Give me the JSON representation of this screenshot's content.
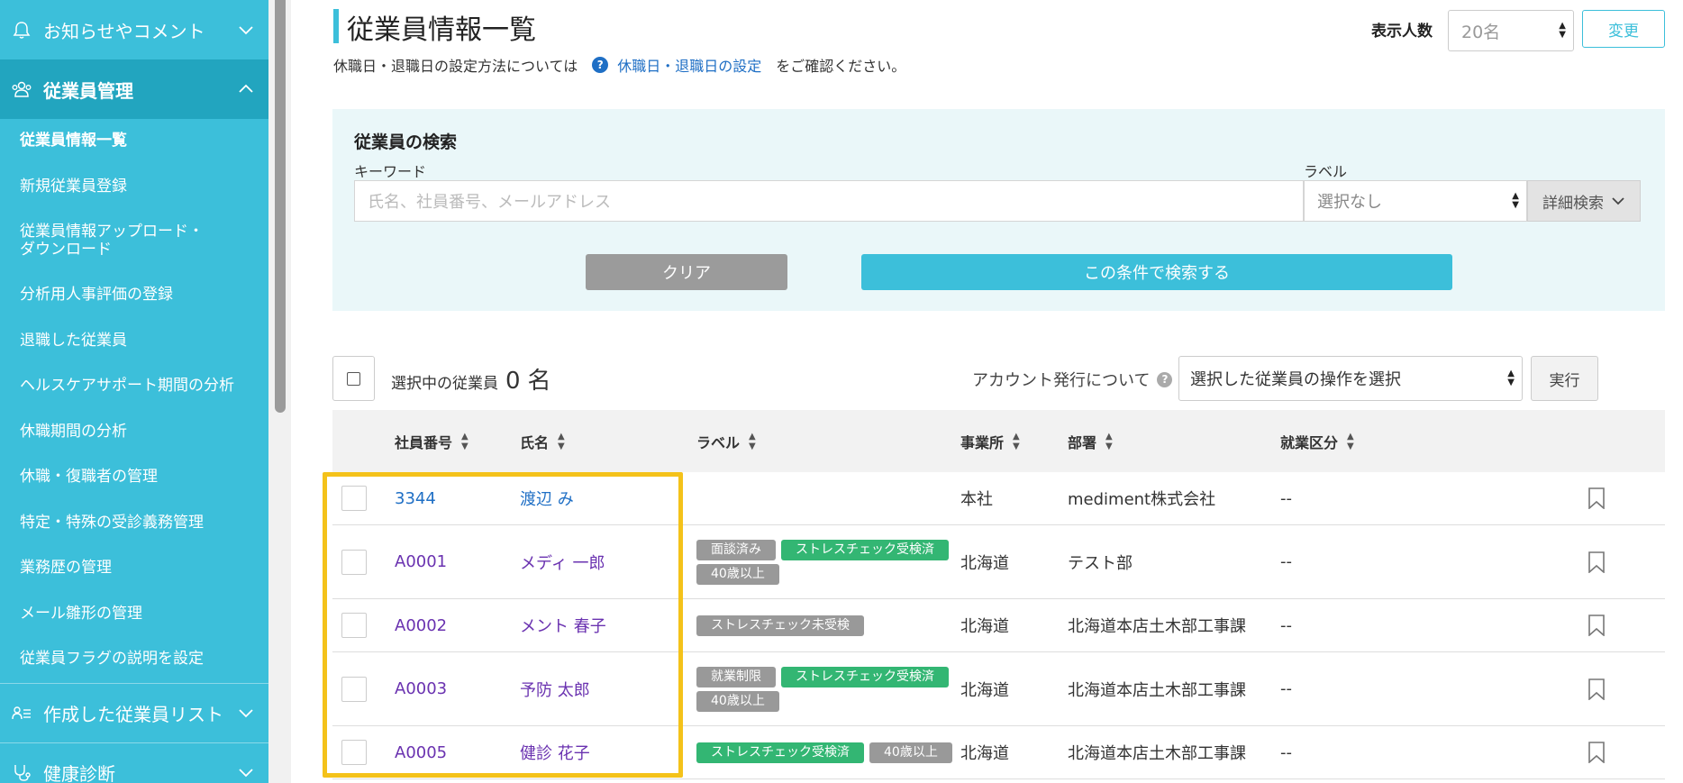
{
  "sidebar": {
    "sections": {
      "notices": "お知らせやコメント",
      "employee_mgmt": "従業員管理",
      "lists": "作成した従業員リスト",
      "health": "健康診断"
    },
    "items": [
      {
        "label": "従業員情報一覧"
      },
      {
        "label": "新規従業員登録"
      },
      {
        "label": "従業員情報アップロード・ダウンロード"
      },
      {
        "label": "分析用人事評価の登録"
      },
      {
        "label": "退職した従業員"
      },
      {
        "label": "ヘルスケアサポート期間の分析"
      },
      {
        "label": "休職期間の分析"
      },
      {
        "label": "休職・復職者の管理"
      },
      {
        "label": "特定・特殊の受診義務管理"
      },
      {
        "label": "業務歴の管理"
      },
      {
        "label": "メール雛形の管理"
      },
      {
        "label": "従業員フラグの説明を設定"
      }
    ]
  },
  "header": {
    "title": "従業員情報一覧",
    "notice_prefix": "休職日・退職日の設定方法については",
    "notice_link": "休職日・退職日の設定",
    "notice_suffix": "をご確認ください。",
    "display_count_label": "表示人数",
    "display_count_value": "20名",
    "change_button": "変更"
  },
  "search": {
    "title": "従業員の検索",
    "keyword_label": "キーワード",
    "keyword_placeholder": "氏名、社員番号、メールアドレス",
    "label_label": "ラベル",
    "label_value": "選択なし",
    "detail_button": "詳細検索",
    "clear_button": "クリア",
    "search_button": "この条件で検索する"
  },
  "selection": {
    "text": "選択中の従業員",
    "count": "0",
    "unit": "名",
    "account_text": "アカウント発行について",
    "operation_placeholder": "選択した従業員の操作を選択",
    "exec_button": "実行"
  },
  "table": {
    "headers": {
      "id": "社員番号",
      "name": "氏名",
      "label": "ラベル",
      "office": "事業所",
      "dept": "部署",
      "work_type": "就業区分"
    },
    "rows": [
      {
        "id": "3344",
        "name": "渡辺 み",
        "tags": [],
        "office": "本社",
        "dept": "mediment株式会社",
        "work_type": "--"
      },
      {
        "id": "A0001",
        "name": "メディ 一郎",
        "tags": [
          {
            "text": "面談済み",
            "color": "gray"
          },
          {
            "text": "ストレスチェック受検済",
            "color": "green"
          },
          {
            "text": "40歳以上",
            "color": "gray"
          }
        ],
        "office": "北海道",
        "dept": "テスト部",
        "work_type": "--"
      },
      {
        "id": "A0002",
        "name": "メント 春子",
        "tags": [
          {
            "text": "ストレスチェック未受検",
            "color": "gray"
          }
        ],
        "office": "北海道",
        "dept": "北海道本店土木部工事課",
        "work_type": "--"
      },
      {
        "id": "A0003",
        "name": "予防 太郎",
        "tags": [
          {
            "text": "就業制限",
            "color": "gray"
          },
          {
            "text": "ストレスチェック受検済",
            "color": "green"
          },
          {
            "text": "40歳以上",
            "color": "gray"
          }
        ],
        "office": "北海道",
        "dept": "北海道本店土木部工事課",
        "work_type": "--"
      },
      {
        "id": "A0005",
        "name": "健診 花子",
        "tags": [
          {
            "text": "ストレスチェック受検済",
            "color": "green"
          },
          {
            "text": "40歳以上",
            "color": "gray"
          }
        ],
        "office": "北海道",
        "dept": "北海道本店土木部工事課",
        "work_type": "--"
      }
    ]
  },
  "colors": {
    "accent": "#3cbfda",
    "sidebar_active": "#22a5bf",
    "link": "#1f6fc5",
    "visited_link": "#6a32b0",
    "tag_green": "#33b673",
    "tag_gray": "#999999",
    "highlight": "#f4c21a"
  }
}
